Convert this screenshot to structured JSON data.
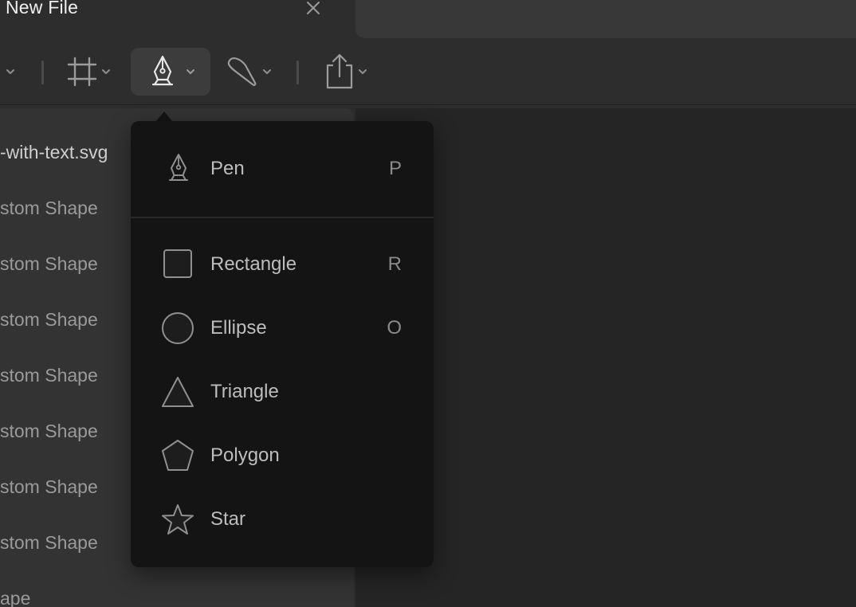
{
  "tab": {
    "title": "New File"
  },
  "toolbar": {
    "items": [
      {
        "icon": "chevron-down-icon"
      },
      {
        "icon": "frame-icon"
      },
      {
        "icon": "pen-tool-icon",
        "active": true
      },
      {
        "icon": "brush-icon"
      },
      {
        "icon": "share-icon"
      }
    ]
  },
  "layers": {
    "items": [
      "-with-text.svg",
      "stom Shape",
      "stom Shape",
      "stom Shape",
      "stom Shape",
      "stom Shape",
      "stom Shape",
      "stom Shape",
      "ape"
    ]
  },
  "menu": {
    "items": [
      {
        "label": "Pen",
        "shortcut": "P",
        "icon": "pen-icon"
      },
      {
        "label": "Rectangle",
        "shortcut": "R",
        "icon": "rectangle-icon"
      },
      {
        "label": "Ellipse",
        "shortcut": "O",
        "icon": "ellipse-icon"
      },
      {
        "label": "Triangle",
        "shortcut": "",
        "icon": "triangle-icon"
      },
      {
        "label": "Polygon",
        "shortcut": "",
        "icon": "polygon-icon"
      },
      {
        "label": "Star",
        "shortcut": "",
        "icon": "star-icon"
      }
    ]
  }
}
